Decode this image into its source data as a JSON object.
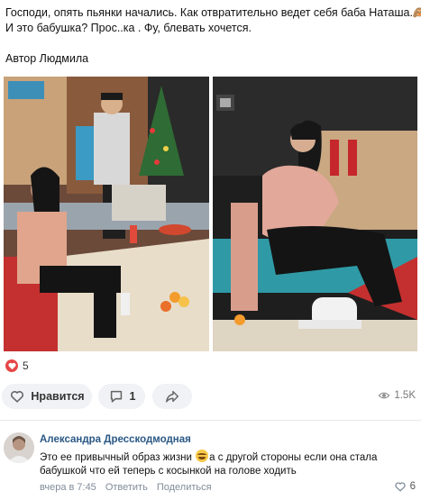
{
  "post": {
    "text_line1": "Господи, опять пьянки начались. Как отвратительно ведет себя баба Наташа.🙈",
    "text_line2": "И это бабушка? Прос..ка . Фу, блевать хочется.",
    "author_line": "Автор Людмила"
  },
  "photos": [
    {
      "icon": "tv-scene-photo"
    },
    {
      "icon": "tv-scene-closeup-photo"
    }
  ],
  "reactions": {
    "icon": "heart-icon",
    "count": "5",
    "color": "#e64646"
  },
  "actions": {
    "like_label": "Нравится",
    "comment_count": "1",
    "views_count": "1.5K"
  },
  "comment": {
    "author": "Александра Дресскодмодная",
    "text_part1": "Это ее привычный образ жизни ",
    "emoji": "rolling-on-floor-laughing",
    "text_part2": "а с другой стороны если она стала бабушкой что ей теперь с косынкой на голове ходить",
    "time": "вчера в 7:45",
    "reply_label": "Ответить",
    "share_label": "Поделиться",
    "likes": "6"
  },
  "colors": {
    "link": "#2a5885",
    "meta": "#818c99",
    "pill": "#f0f2f5"
  }
}
